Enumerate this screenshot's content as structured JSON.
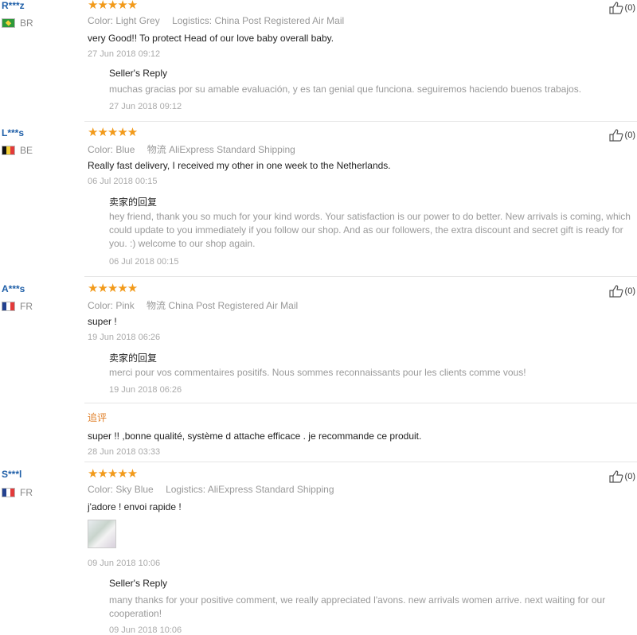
{
  "reviews": [
    {
      "user": "R***z",
      "country": "BR",
      "color_label": "Color:",
      "color_value": "Light Grey",
      "logistics_label": "Logistics:",
      "logistics_value": "China Post Registered Air Mail",
      "feedback": "very Good!! To protect Head of our love baby overall baby.",
      "date": "27 Jun 2018 09:12",
      "reply_title": "Seller's Reply",
      "reply_text": "muchas gracias por su amable evaluación, y es tan genial que funciona. seguiremos haciendo buenos trabajos.",
      "reply_date": "27 Jun 2018 09:12",
      "likes": "(0)"
    },
    {
      "user": "L***s",
      "country": "BE",
      "color_label": "Color:",
      "color_value": "Blue",
      "logistics_label": "物流",
      "logistics_value": "AliExpress Standard Shipping",
      "feedback": "Really fast delivery, I received my other in one week to the Netherlands.",
      "date": "06 Jul 2018 00:15",
      "reply_title": "卖家的回复",
      "reply_text": "hey friend, thank you so much for your kind words. Your satisfaction is our power to do better. New arrivals is coming, which could update to you immediately if you follow our shop. And as our followers, the extra discount and secret gift is ready for you. :) welcome to our shop again.",
      "reply_date": "06 Jul 2018 00:15",
      "likes": "(0)"
    },
    {
      "user": "A***s",
      "country": "FR",
      "color_label": "Color:",
      "color_value": "Pink",
      "logistics_label": "物流",
      "logistics_value": "China Post Registered Air Mail",
      "feedback": "super !",
      "date": "19 Jun 2018 06:26",
      "reply_title": "卖家的回复",
      "reply_text": "merci pour vos commentaires positifs. Nous sommes reconnaissants pour les clients comme vous!",
      "reply_date": "19 Jun 2018 06:26",
      "additional_label": "追评",
      "additional_text": "super !! ,bonne qualité, système d attache efficace . je recommande ce produit.",
      "additional_date": "28 Jun 2018 03:33",
      "likes": "(0)"
    },
    {
      "user": "S***l",
      "country": "FR",
      "color_label": "Color:",
      "color_value": "Sky Blue",
      "logistics_label": "Logistics:",
      "logistics_value": "AliExpress Standard Shipping",
      "feedback": "j'adore ! envoi rapide !",
      "date": "09 Jun 2018 10:06",
      "reply_title": "Seller's Reply",
      "reply_text": "many thanks for your positive comment, we really appreciated l'avons. new arrivals women arrive. next waiting for our cooperation!",
      "reply_date": "09 Jun 2018 10:06",
      "likes": "(0)"
    }
  ],
  "rating_stars": "★★★★★",
  "icons": {
    "like": "thumbs-up-icon",
    "photo": "review-photo-thumbnail"
  },
  "colors": {
    "user": "#1f5fa8",
    "stars": "#f29a1a",
    "additional": "#e0802a"
  }
}
